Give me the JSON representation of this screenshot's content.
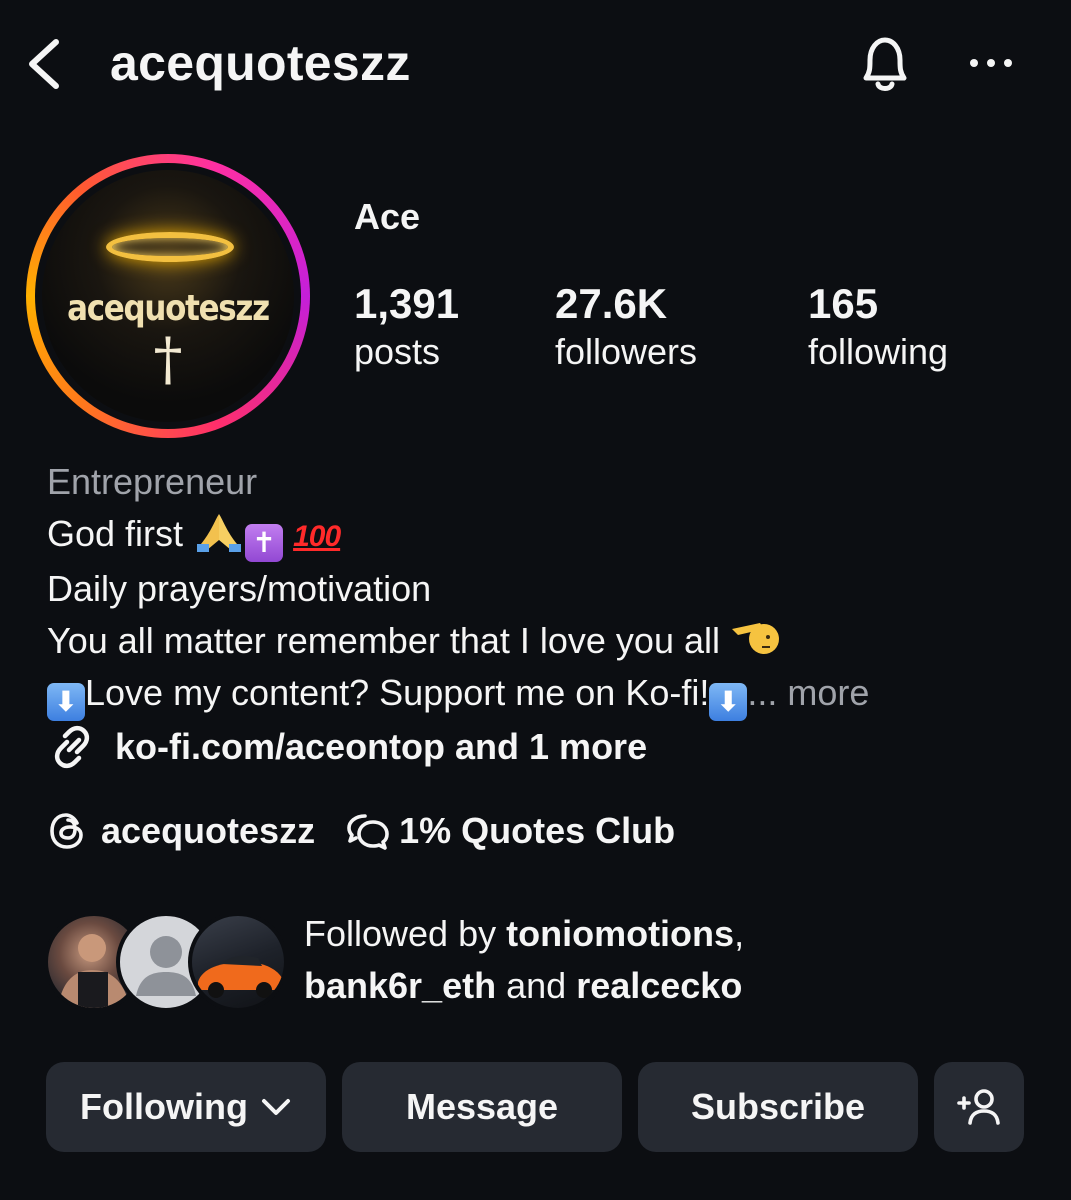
{
  "header": {
    "username": "acequoteszz"
  },
  "profile": {
    "avatar_text": "acequoteszz",
    "avatar_cross": "†",
    "display_name": "Ace",
    "stats": [
      {
        "value": "1,391",
        "label": "posts"
      },
      {
        "value": "27.6K",
        "label": "followers"
      },
      {
        "value": "165",
        "label": "following"
      }
    ]
  },
  "bio": {
    "category": "Entrepreneur",
    "line1": "God first",
    "line2": "Daily prayers/motivation",
    "line3": "You all matter remember that I love you all",
    "line4": "Love my content? Support me on Ko-fi!",
    "more": "... more",
    "emoji_100": "100",
    "emoji_cross": "✝",
    "emoji_down": "⬇"
  },
  "link": {
    "text": "ko-fi.com/aceontop and 1 more"
  },
  "threads": {
    "handle": "acequoteszz",
    "channel": "1% Quotes Club"
  },
  "followed_by": {
    "prefix": "Followed by",
    "user1": "toniomotions",
    "sep": ",",
    "user2": "bank6r_eth",
    "and": "and",
    "user3": "realcecko"
  },
  "buttons": {
    "following": "Following",
    "message": "Message",
    "subscribe": "Subscribe"
  },
  "colors": {
    "background": "#0c0e12",
    "button": "#262a32",
    "muted_text": "#a0a3aa"
  }
}
